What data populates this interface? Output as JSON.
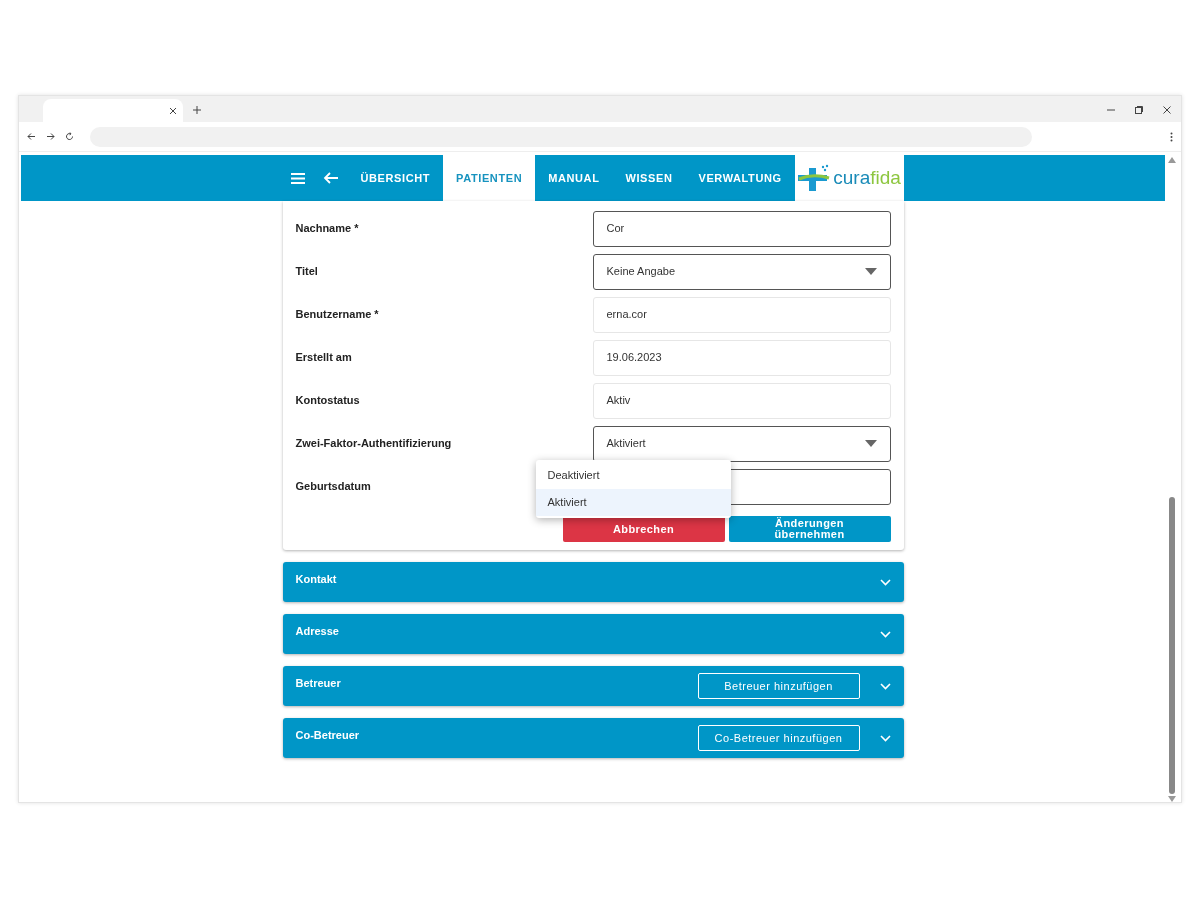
{
  "navbar": {
    "items": [
      {
        "label": "ÜBERSICHT",
        "selected": false
      },
      {
        "label": "PATIENTEN",
        "selected": true
      },
      {
        "label": "MANUAL",
        "selected": false
      },
      {
        "label": "WISSEN",
        "selected": false
      },
      {
        "label": "VERWALTUNG",
        "selected": false
      }
    ],
    "logo": {
      "part_1": "cura",
      "part_2": "fida"
    }
  },
  "form": {
    "fields": [
      {
        "label": "Nachname *",
        "kind": "text",
        "value": "Cor"
      },
      {
        "label": "Titel",
        "kind": "select",
        "value": "Keine Angabe"
      },
      {
        "label": "Benutzername *",
        "kind": "readonly",
        "value": "erna.cor"
      },
      {
        "label": "Erstellt am",
        "kind": "readonly",
        "value": "19.06.2023"
      },
      {
        "label": "Kontostatus",
        "kind": "readonly",
        "value": "Aktiv"
      },
      {
        "label": "Zwei-Faktor-Authentifizierung",
        "kind": "select",
        "value": "Aktiviert"
      },
      {
        "label": "Geburtsdatum",
        "kind": "text"
      }
    ],
    "buttons": [
      {
        "label": "Abbrechen",
        "kind": "cancel"
      },
      {
        "label": "Änderungen übernehmen",
        "kind": "submit"
      }
    ]
  },
  "dropdown": {
    "options": [
      {
        "label": "Deaktiviert",
        "selected": false
      },
      {
        "label": "Aktiviert",
        "selected": true
      }
    ]
  },
  "sections": [
    {
      "title": "Kontakt",
      "expanded": false
    },
    {
      "title": "Adresse",
      "expanded": false
    },
    {
      "title": "Betreuer",
      "expanded": false,
      "action": "Betreuer hinzufügen"
    },
    {
      "title": "Co-Betreuer",
      "expanded": false,
      "action": "Co-Betreuer hinzufügen"
    }
  ]
}
